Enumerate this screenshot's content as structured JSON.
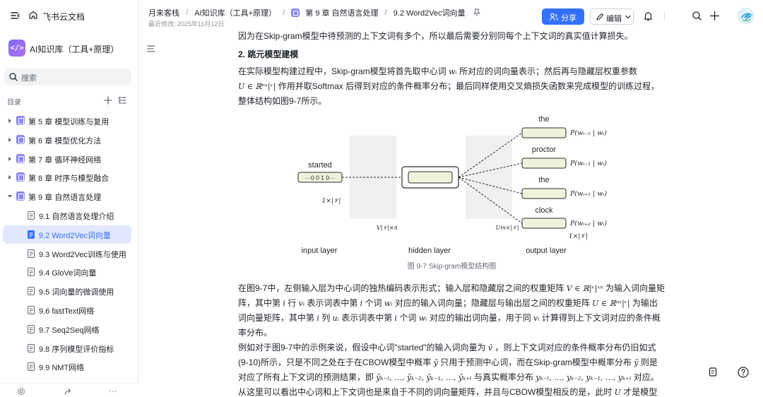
{
  "sidebar": {
    "brand": "飞书云文档",
    "kb_logo": "</>",
    "kb_title": "AI知识库（工具+原理）",
    "search_placeholder": "搜索",
    "toc_label": "目录",
    "items": [
      {
        "label": "第 5 章 模型训练与复用",
        "type": "chapter",
        "expanded": false
      },
      {
        "label": "第 6 章 模型优化方法",
        "type": "chapter",
        "expanded": false
      },
      {
        "label": "第 7 章 循环神经网络",
        "type": "chapter",
        "expanded": false
      },
      {
        "label": "第 8 章 时序与模型融合",
        "type": "chapter",
        "expanded": false
      },
      {
        "label": "第 9 章 自然语言处理",
        "type": "chapter",
        "expanded": true
      },
      {
        "label": "9.1 自然语言处理介绍",
        "type": "doc"
      },
      {
        "label": "9.2 Word2Vec词向量",
        "type": "doc",
        "active": true
      },
      {
        "label": "9.3 Word2Vec训练与使用",
        "type": "doc"
      },
      {
        "label": "9.4 GloVe词向量",
        "type": "doc"
      },
      {
        "label": "9.5 词向量的微调使用",
        "type": "doc"
      },
      {
        "label": "9.6 fastText网络",
        "type": "doc"
      },
      {
        "label": "9.7 Seq2Seq网络",
        "type": "doc"
      },
      {
        "label": "9.8 序列模型评价指标",
        "type": "doc"
      },
      {
        "label": "9.9 NMT网络",
        "type": "doc"
      }
    ],
    "bottom_more": "···"
  },
  "header": {
    "breadcrumb": [
      "月来客栈",
      "AI知识库（工具+原理）",
      "第 9 章 自然语言处理",
      "9.2 Word2Vec词向量"
    ],
    "modified": "最近修改: 2025年11月12日",
    "share_label": "分享",
    "edit_label": "编辑"
  },
  "doc": {
    "p0": "因为在Skip-gram模型中待预测的上下文词有多个，所以最后需要分别同每个上下文词的真实值计算损失。",
    "h2": "2. 跳元模型建模",
    "p1_a": "在实际模型构建过程中，Skip-gram模型将首先取中心词 ",
    "p1_m1": "wᵢ",
    "p1_b": " 所对应的词向量表示；然后再与隐藏层权重参数",
    "p1_m2": "U ∈ ℝⁿˣ|ᵛ|",
    "p1_c": " 作用并取Softmax 后得到对应的条件概率分布；最后同样使用交叉熵损失函数来完成模型的训练过程，整体结构如图9-7所示。",
    "p2_a": "在图9-7中，左侧输入层为中心词的独热编码表示形式；输入层和隐藏层之间的权重矩阵 ",
    "p2_m1": "V ∈ ℝ|ᵛ|ˣⁿ",
    "p2_b": " 为输入词向量矩阵，其中第 ",
    "p2_m2": "i",
    "p2_c": " 行 ",
    "p2_m3": "vᵢ",
    "p2_d": " 表示词表中第 ",
    "p2_m4": "i",
    "p2_e": " 个词 ",
    "p2_m5": "wᵢ",
    "p2_f": " 对应的输入词向量；隐藏层与输出层之间的权重矩阵 ",
    "p2_m6": "U ∈ ℝⁿˣ|ᵛ|",
    "p2_g": " 为输出词向量矩阵，其中第 ",
    "p2_m7": "i",
    "p2_h": " 列 ",
    "p2_m8": "uᵢ",
    "p2_i": " 表示词表中第 ",
    "p2_m9": "i",
    "p2_j": " 个词 ",
    "p2_m10": "wᵢ",
    "p2_k": " 对应的输出词向量，用于同 ",
    "p2_m11": "vᵢ",
    "p2_l": " 计算得到上下文词对应的条件概率分布。",
    "p3_a": "例如对于图9-7中的示例来说，假设中心词\"started\"的输入词向量为 ",
    "p3_m1": "v̂",
    "p3_b": " ，则上下文词对应的条件概率分布仍旧如式(9-10)所示，只是不同之处在于在CBOW模型中概率 ",
    "p3_m2": "ŷ",
    "p3_c": " 只用于预测中心词，而在Skip-gram模型中概率分布 ",
    "p3_m3": "ŷ",
    "p3_d": " 则是对应了所有上下文词的预测结果，即 ",
    "p3_m4": "ŷₖ₋ₗ, …, ŷₖ₋₂, ŷₖ₋₁, …, ŷₖ₊ₗ",
    "p3_e": " 与真实概率分布 ",
    "p3_m5": "yₖ₋ₗ, …, yₖ₋₂, yₖ₋₁, …, yₖ₊ₗ",
    "p3_f": " 对应。",
    "p4_a": "从这里可以看出中心词和上下文词也是来自于不同的词向量矩阵，并且与CBOW模型相反的是，此时 ",
    "p4_m1": "U",
    "p4_b": " 才是模型训",
    "caption": "图 9-7 Skip-gram模型结构图"
  },
  "figure": {
    "input_word": "started",
    "input_vector": "···0 0 1 0···",
    "input_dim": "1×|𝒱|",
    "v_label": "V|𝒱|×n",
    "u_label": "Um×|𝒱|",
    "output_dim": "1×|𝒱|",
    "outputs": [
      {
        "word": "the",
        "prob": "P(wᵢ₋₂ | wᵢ)"
      },
      {
        "word": "proctor",
        "prob": "P(wᵢ₋₁ | wᵢ)"
      },
      {
        "word": "the",
        "prob": "P(wᵢ₊₁ | wᵢ)"
      },
      {
        "word": "clock",
        "prob": "P(wᵢ₊₂ | wᵢ)"
      }
    ],
    "layer_labels": [
      "input layer",
      "hidden layer",
      "output layer"
    ],
    "box_fill": "#eef3dc",
    "box_stroke": "#2b2b2b"
  },
  "colors": {
    "accent": "#3370ff",
    "active_bg": "#e1e8fd",
    "chapter_icon": "#8a88f2"
  }
}
